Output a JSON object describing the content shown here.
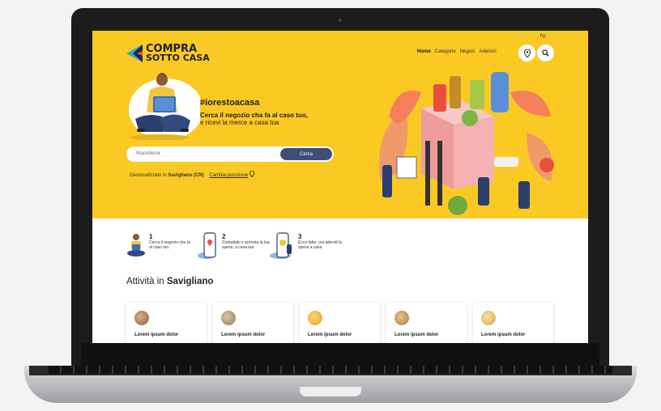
{
  "header": {
    "social_icons": "f◎",
    "logo": {
      "line1": "COMPRA",
      "line2": "SOTTO CASA"
    },
    "nav": [
      "Home",
      "Categorie",
      "Negozi",
      "Aderisci"
    ]
  },
  "hero": {
    "hashtag": "#iorestoacasa",
    "tagline_line1": "Cerca il negozio cha fa al caso tuo,",
    "tagline_line2": "e ricevi la merce a casa tua",
    "search_placeholder": "Macelleria",
    "search_button": "Cerca",
    "geo_prefix": "Geolocalizzato in",
    "geo_place": "Savigliano (CN)",
    "geo_change": "Cambia posizione"
  },
  "steps": [
    {
      "num": "1",
      "text": "Cerca il negozio che fa al caso tuo."
    },
    {
      "num": "2",
      "text": "Contattalo e prenota la tua spesa, a casa tua"
    },
    {
      "num": "3",
      "text": "Ecco fatto, ora attendi la spesa a casa"
    }
  ],
  "activities": {
    "title_prefix": "Attività in",
    "title_place": "Savigliano",
    "cards": [
      "Lorem ipsum dolor",
      "Lorem ipsum dolor",
      "Lorem ipsum dolor",
      "Lorem ipsum dolor",
      "Lorem ipsum dolor"
    ]
  },
  "colors": {
    "brand_yellow": "#fbc924",
    "button_navy": "#3f4e74"
  }
}
